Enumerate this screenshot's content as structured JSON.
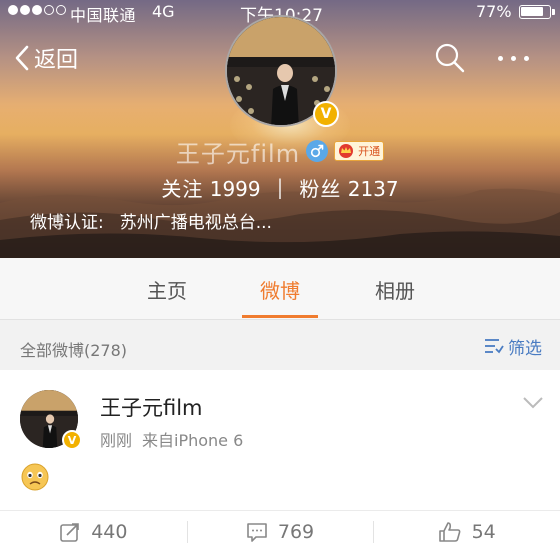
{
  "status_bar": {
    "carrier": "中国联通",
    "network": "4G",
    "time": "下午10:27",
    "battery_pct": "77%"
  },
  "nav": {
    "back_label": "返回"
  },
  "profile": {
    "name": "王子元film",
    "member_badge_label": "开通",
    "following_label": "关注",
    "following_count": "1999",
    "separator": "|",
    "followers_label": "粉丝",
    "followers_count": "2137",
    "verify_label": "微博认证:",
    "verify_value": "苏州广播电视总台..."
  },
  "tabs": [
    {
      "label": "主页",
      "active": false
    },
    {
      "label": "微博",
      "active": true
    },
    {
      "label": "相册",
      "active": false
    }
  ],
  "filter": {
    "count_label": "全部微博(278)",
    "filter_label": "筛选"
  },
  "post": {
    "author": "王子元film",
    "time": "刚刚",
    "source": "来自iPhone 6",
    "repost_count": "440",
    "comment_count": "769",
    "like_count": "54"
  },
  "colors": {
    "accent": "#f07c2f",
    "link": "#4a7cc2",
    "verified_badge": "#f2b100",
    "gender": "#5aa8e8"
  },
  "icons": {
    "back": "chevron-left-icon",
    "search": "search-icon",
    "more": "more-dots-icon",
    "gender": "male-icon",
    "verified": "verified-v-icon",
    "filter": "filter-icon",
    "chevron": "chevron-down-icon",
    "emoji": "sad-face-emoji",
    "repost": "repost-icon",
    "comment": "comment-icon",
    "like": "thumbs-up-icon"
  }
}
